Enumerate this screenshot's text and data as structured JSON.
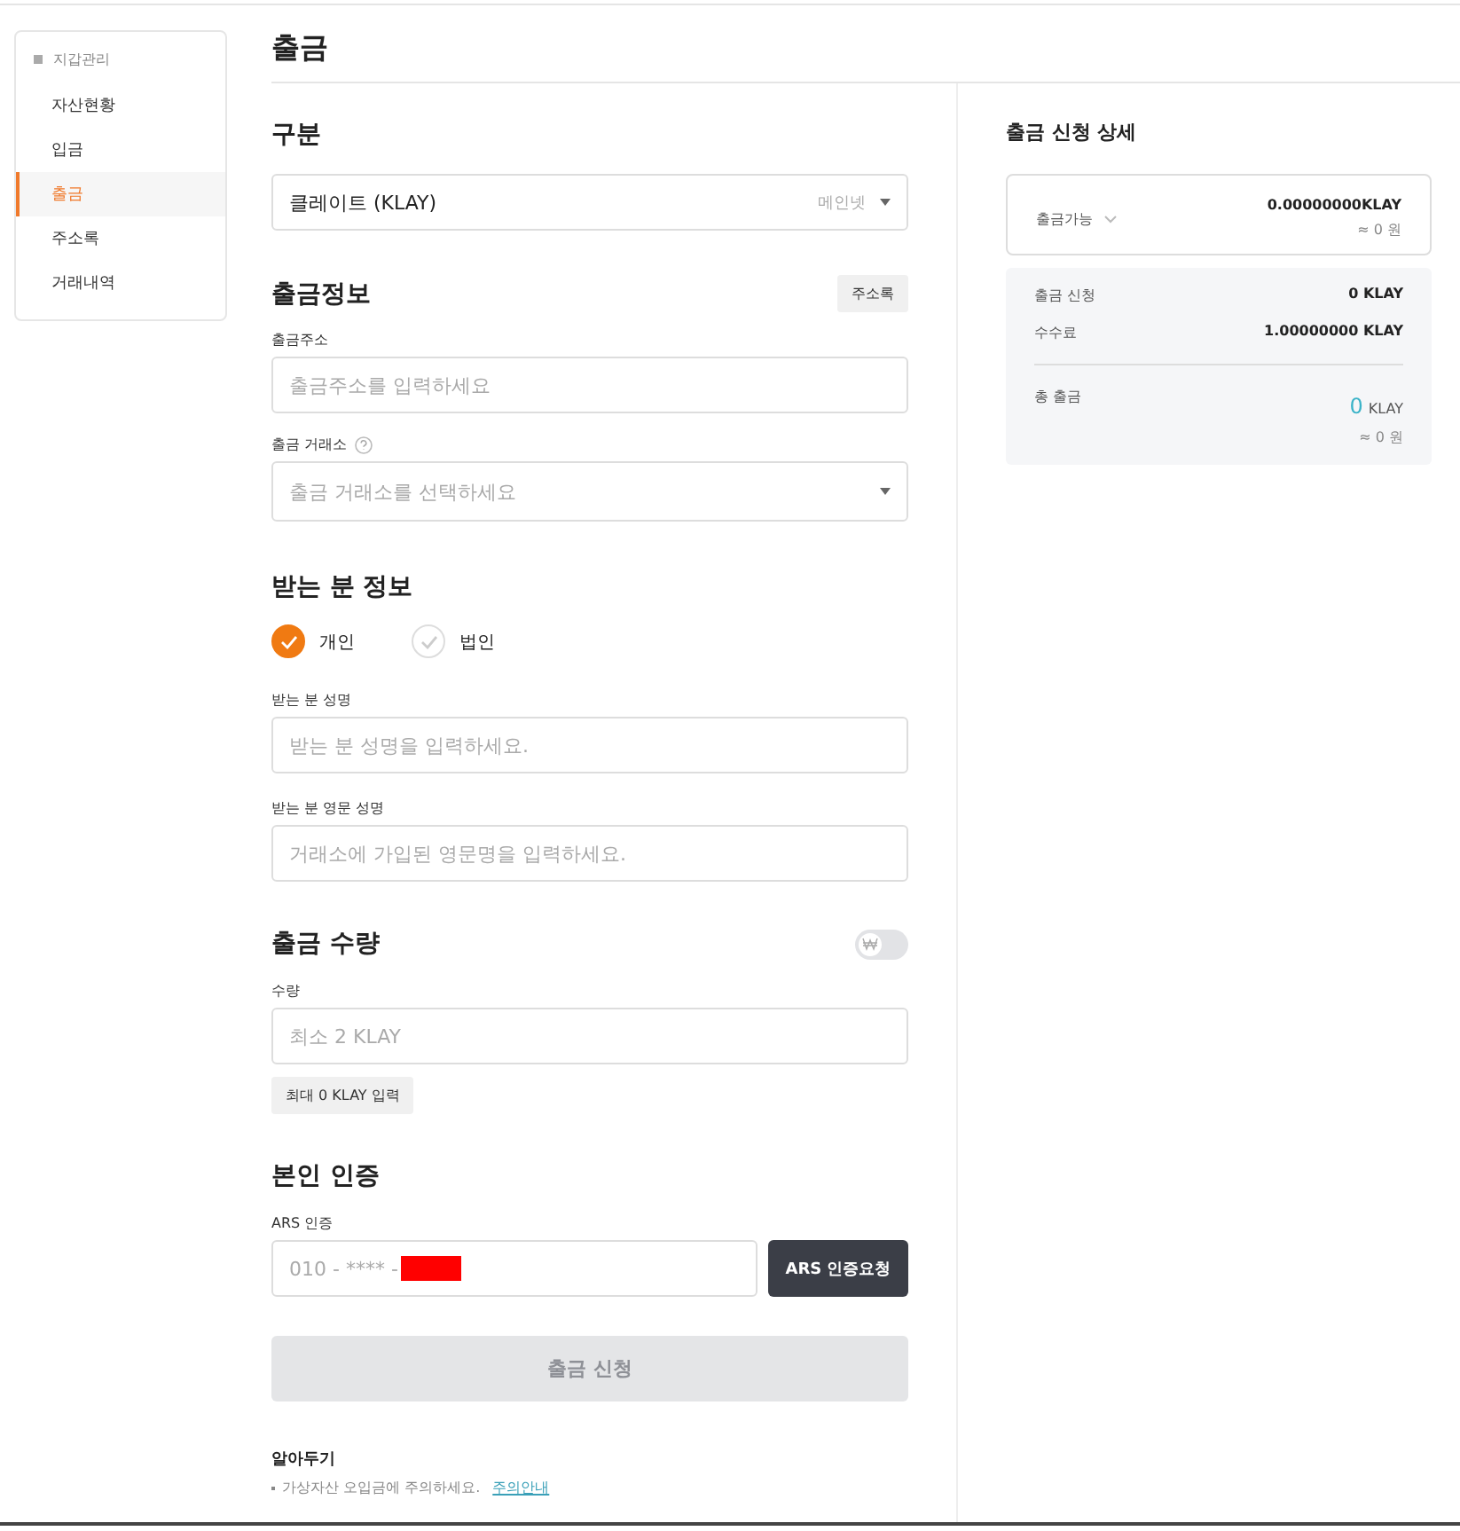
{
  "sidebar": {
    "title": "지갑관리",
    "items": [
      {
        "label": "자산현황",
        "selected": false
      },
      {
        "label": "입금",
        "selected": false
      },
      {
        "label": "출금",
        "selected": true
      },
      {
        "label": "주소록",
        "selected": false
      },
      {
        "label": "거래내역",
        "selected": false
      }
    ]
  },
  "page_title": "출금",
  "category": {
    "heading": "구분",
    "coin": "클레이트 (KLAY)",
    "network": "메인넷"
  },
  "withdraw_info": {
    "heading": "출금정보",
    "address_book_button": "주소록",
    "address": {
      "label": "출금주소",
      "placeholder": "출금주소를 입력하세요"
    },
    "exchange": {
      "label": "출금 거래소",
      "placeholder": "출금 거래소를 선택하세요"
    }
  },
  "recipient": {
    "heading": "받는 분 정보",
    "types": [
      {
        "label": "개인",
        "selected": true
      },
      {
        "label": "법인",
        "selected": false
      }
    ],
    "name": {
      "label": "받는 분 성명",
      "placeholder": "받는 분 성명을 입력하세요."
    },
    "english_name": {
      "label": "받는 분 영문 성명",
      "placeholder": "거래소에 가입된 영문명을 입력하세요."
    }
  },
  "amount": {
    "heading": "출금 수량",
    "krw_toggle": {
      "on": false
    },
    "label": "수량",
    "placeholder": "최소 2 KLAY",
    "max_button": "최대 0 KLAY 입력"
  },
  "verification": {
    "heading": "본인 인증",
    "label": "ARS 인증",
    "phone": "010 - **** -",
    "request_button": "ARS 인증요청"
  },
  "submit": {
    "label": "출금 신청",
    "disabled": true
  },
  "notice": {
    "heading": "알아두기",
    "text": "가상자산 오입금에 주의하세요.",
    "link": "주의안내"
  },
  "summary": {
    "heading": "출금 신청 상세",
    "available": {
      "label": "출금가능",
      "amount": "0.00000000",
      "unit": "KLAY",
      "krw": "≈ 0 원"
    },
    "rows": [
      {
        "label": "출금 신청",
        "amount": "0",
        "unit": "KLAY"
      },
      {
        "label": "수수료",
        "amount": "1.00000000",
        "unit": "KLAY"
      }
    ],
    "total": {
      "label": "총 출금",
      "amount": "0",
      "unit": "KLAY",
      "krw": "≈ 0 원"
    }
  }
}
